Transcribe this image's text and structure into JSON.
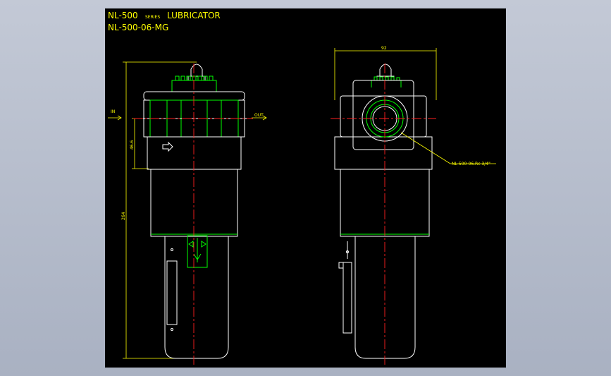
{
  "drawing": {
    "title_prefix": "NL-500",
    "title_series": "SERIES",
    "title_suffix": "LUBRICATOR",
    "model": "NL-500-06-MG"
  },
  "front_view": {
    "in_label": "IN",
    "out_label": "OUT",
    "dim_height": "46.6",
    "dim_total": "264"
  },
  "side_view": {
    "dim_width": "92",
    "port_callout": "NL-500-06.Rc 3/4\""
  },
  "colors": {
    "background": "#000000",
    "outline": "#ffffff",
    "detail": "#00ff00",
    "centerline": "#ff2020",
    "dimension": "#ffff00",
    "frame": "#b0b8c8"
  }
}
